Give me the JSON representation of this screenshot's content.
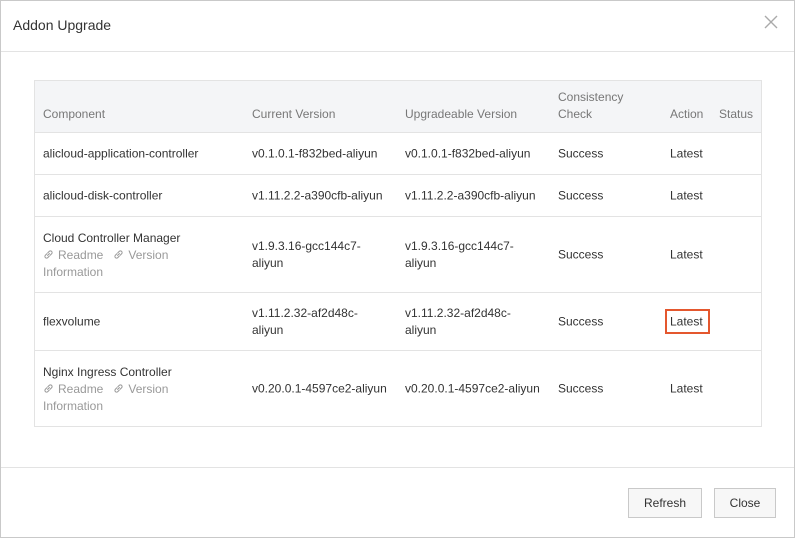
{
  "dialog": {
    "title": "Addon Upgrade",
    "close_icon": "close-icon"
  },
  "table": {
    "headers": {
      "component": "Component",
      "current_version": "Current Version",
      "upgradeable_version": "Upgradeable Version",
      "consistency_line1": "Consistency",
      "consistency_line2": "Check",
      "action": "Action",
      "status": "Status"
    },
    "rows": [
      {
        "component": "alicloud-application-controller",
        "current_l1": "v0.1.0.1-f832bed-aliyun",
        "current_l2": "",
        "upgradeable_l1": "v0.1.0.1-f832bed-aliyun",
        "upgradeable_l2": "",
        "consistency": "Success",
        "action": "Latest"
      },
      {
        "component": "alicloud-disk-controller",
        "current_l1": "v1.11.2.2-a390cfb-aliyun",
        "current_l2": "",
        "upgradeable_l1": "v1.11.2.2-a390cfb-aliyun",
        "upgradeable_l2": "",
        "consistency": "Success",
        "action": "Latest"
      },
      {
        "component": "Cloud Controller Manager",
        "readme": "Readme",
        "version_info_l1": "Version",
        "version_info_l2": "Information",
        "current_l1": "v1.9.3.16-gcc144c7-",
        "current_l2": "aliyun",
        "upgradeable_l1": "v1.9.3.16-gcc144c7-",
        "upgradeable_l2": "aliyun",
        "consistency": "Success",
        "action": "Latest"
      },
      {
        "component": "flexvolume",
        "current_l1": "v1.11.2.32-af2d48c-",
        "current_l2": "aliyun",
        "upgradeable_l1": "v1.11.2.32-af2d48c-",
        "upgradeable_l2": "aliyun",
        "consistency": "Success",
        "action": "Latest"
      },
      {
        "component": "Nginx Ingress Controller",
        "readme": "Readme",
        "version_info_l1": "Version",
        "version_info_l2": "Information",
        "current_l1": "v0.20.0.1-4597ce2-aliyun",
        "current_l2": "",
        "upgradeable_l1": "v0.20.0.1-4597ce2-aliyun",
        "upgradeable_l2": "",
        "consistency": "Success",
        "action": "Latest"
      }
    ]
  },
  "footer": {
    "refresh_label": "Refresh",
    "close_label": "Close"
  },
  "colors": {
    "highlight": "#e4572e",
    "header_bg": "#f4f5f7",
    "border": "#e3e3e3"
  }
}
